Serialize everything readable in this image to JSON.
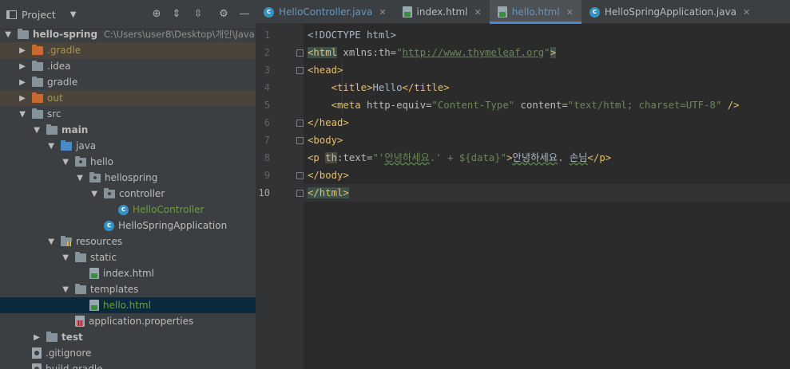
{
  "project_panel": {
    "title": "Project",
    "tree": [
      {
        "label": "hello-spring",
        "hint": "C:\\Users\\user8\\Desktop\\개인\\Java",
        "depth": 0,
        "expanded": true,
        "icon": "folder-icon",
        "bold": true
      },
      {
        "label": ".gradle",
        "depth": 1,
        "expanded": false,
        "icon": "folder-orange-icon",
        "excluded": true
      },
      {
        "label": ".idea",
        "depth": 1,
        "expanded": false,
        "icon": "folder-icon"
      },
      {
        "label": "gradle",
        "depth": 1,
        "expanded": false,
        "icon": "folder-icon"
      },
      {
        "label": "out",
        "depth": 1,
        "expanded": false,
        "icon": "folder-orange-icon",
        "excluded": true
      },
      {
        "label": "src",
        "depth": 1,
        "expanded": true,
        "icon": "folder-icon"
      },
      {
        "label": "main",
        "depth": 2,
        "expanded": true,
        "icon": "folder-icon",
        "bold": true
      },
      {
        "label": "java",
        "depth": 3,
        "expanded": true,
        "icon": "folder-blue-icon"
      },
      {
        "label": "hello",
        "depth": 4,
        "expanded": true,
        "icon": "package-icon"
      },
      {
        "label": "hellospring",
        "depth": 5,
        "expanded": true,
        "icon": "package-icon"
      },
      {
        "label": "controller",
        "depth": 6,
        "expanded": true,
        "icon": "package-icon"
      },
      {
        "label": "HelloController",
        "depth": 7,
        "icon": "class-icon",
        "leaf": true
      },
      {
        "label": "HelloSpringApplication",
        "depth": 6,
        "icon": "spring-class-icon",
        "leaf": true
      },
      {
        "label": "resources",
        "depth": 3,
        "expanded": true,
        "icon": "resources-folder-icon"
      },
      {
        "label": "static",
        "depth": 4,
        "expanded": true,
        "icon": "folder-icon"
      },
      {
        "label": "index.html",
        "depth": 5,
        "icon": "html-file-icon",
        "leaf": true
      },
      {
        "label": "templates",
        "depth": 4,
        "expanded": true,
        "icon": "folder-icon"
      },
      {
        "label": "hello.html",
        "depth": 5,
        "icon": "html-file-icon",
        "leaf": true,
        "selected": true
      },
      {
        "label": "application.properties",
        "depth": 4,
        "icon": "properties-file-icon",
        "leaf": true
      },
      {
        "label": "test",
        "depth": 2,
        "expanded": false,
        "icon": "folder-icon",
        "bold": true
      },
      {
        "label": ".gitignore",
        "depth": 1,
        "icon": "gitignore-file-icon",
        "leaf": true
      },
      {
        "label": "build.gradle",
        "depth": 1,
        "icon": "gradle-file-icon",
        "leaf": true
      }
    ]
  },
  "editor": {
    "tabs": [
      {
        "label": "HelloController.java",
        "icon": "class-icon",
        "color": "blue"
      },
      {
        "label": "index.html",
        "icon": "html-file-icon",
        "color": "normal"
      },
      {
        "label": "hello.html",
        "icon": "html-file-icon",
        "color": "blue",
        "active": true
      },
      {
        "label": "HelloSpringApplication.java",
        "icon": "spring-class-icon",
        "color": "normal"
      }
    ],
    "current_line": 10,
    "lines": [
      [
        [
          "t-text",
          "<!DOCTYPE html>"
        ]
      ],
      [
        [
          "t-tag tag-hl",
          "<html"
        ],
        [
          "t-attr",
          " xmlns:"
        ],
        [
          "t-attr",
          "th"
        ],
        [
          "t-attr",
          "="
        ],
        [
          "t-str",
          "\""
        ],
        [
          "t-url",
          "http://www.thymeleaf.org"
        ],
        [
          "t-str",
          "\""
        ],
        [
          "t-tag tag-hl",
          ">"
        ]
      ],
      [
        [
          "t-tag",
          "<head>"
        ]
      ],
      [
        [
          "t-text",
          "    "
        ],
        [
          "t-tag",
          "<title>"
        ],
        [
          "t-text",
          "Hello"
        ],
        [
          "t-tag",
          "</title>"
        ]
      ],
      [
        [
          "t-text",
          "    "
        ],
        [
          "t-tag",
          "<meta"
        ],
        [
          "t-attr",
          " http-equiv="
        ],
        [
          "t-str",
          "\"Content-Type\""
        ],
        [
          "t-attr",
          " content="
        ],
        [
          "t-str",
          "\"text/html; charset=UTF-8\""
        ],
        [
          "t-tag",
          " />"
        ]
      ],
      [
        [
          "t-tag",
          "</head>"
        ]
      ],
      [
        [
          "t-tag",
          "<body>"
        ]
      ],
      [
        [
          "t-tag",
          "<p "
        ],
        [
          "t-attr t-ns",
          "th"
        ],
        [
          "t-attr",
          ":text="
        ],
        [
          "t-str",
          "\"'"
        ],
        [
          "t-str t-typo",
          "안녕하세요"
        ],
        [
          "t-str",
          ".' + ${data}\""
        ],
        [
          "t-tag",
          ">"
        ],
        [
          "t-text t-typo",
          "안녕하세요"
        ],
        [
          "t-text",
          ". "
        ],
        [
          "t-text t-typo",
          "손님"
        ],
        [
          "t-tag",
          "</p>"
        ]
      ],
      [
        [
          "t-tag",
          "</body>"
        ]
      ],
      [
        [
          "t-tag tag-hl",
          "</html>"
        ]
      ]
    ]
  },
  "colors": {
    "accent": "#4a88c7",
    "selection": "#0d293e",
    "excluded_bg": "#4a443a"
  }
}
